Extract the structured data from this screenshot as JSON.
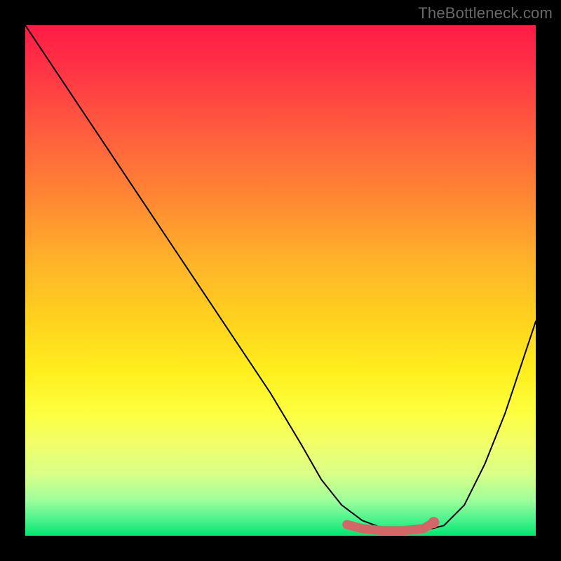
{
  "watermark": "TheBottleneck.com",
  "chart_data": {
    "type": "line",
    "title": "",
    "xlabel": "",
    "ylabel": "",
    "xlim": [
      0,
      100
    ],
    "ylim": [
      0,
      100
    ],
    "series": [
      {
        "name": "bottleneck-curve",
        "x": [
          0,
          8,
          16,
          24,
          32,
          40,
          48,
          54,
          58,
          62,
          66,
          70,
          74,
          78,
          82,
          86,
          90,
          94,
          98,
          100
        ],
        "values": [
          100,
          88,
          76,
          64,
          52,
          40,
          28,
          18,
          11,
          6,
          3,
          1.5,
          1,
          1,
          2,
          6,
          14,
          24,
          36,
          42
        ]
      },
      {
        "name": "flat-region-marker",
        "x": [
          63,
          66,
          70,
          74,
          78,
          80
        ],
        "values": [
          2.2,
          1.4,
          1.0,
          1.0,
          1.4,
          2.6
        ]
      }
    ],
    "colors": {
      "curve": "#000000",
      "marker": "#d36767",
      "gradient_top": "#ff1b45",
      "gradient_bottom": "#00e66e"
    }
  }
}
